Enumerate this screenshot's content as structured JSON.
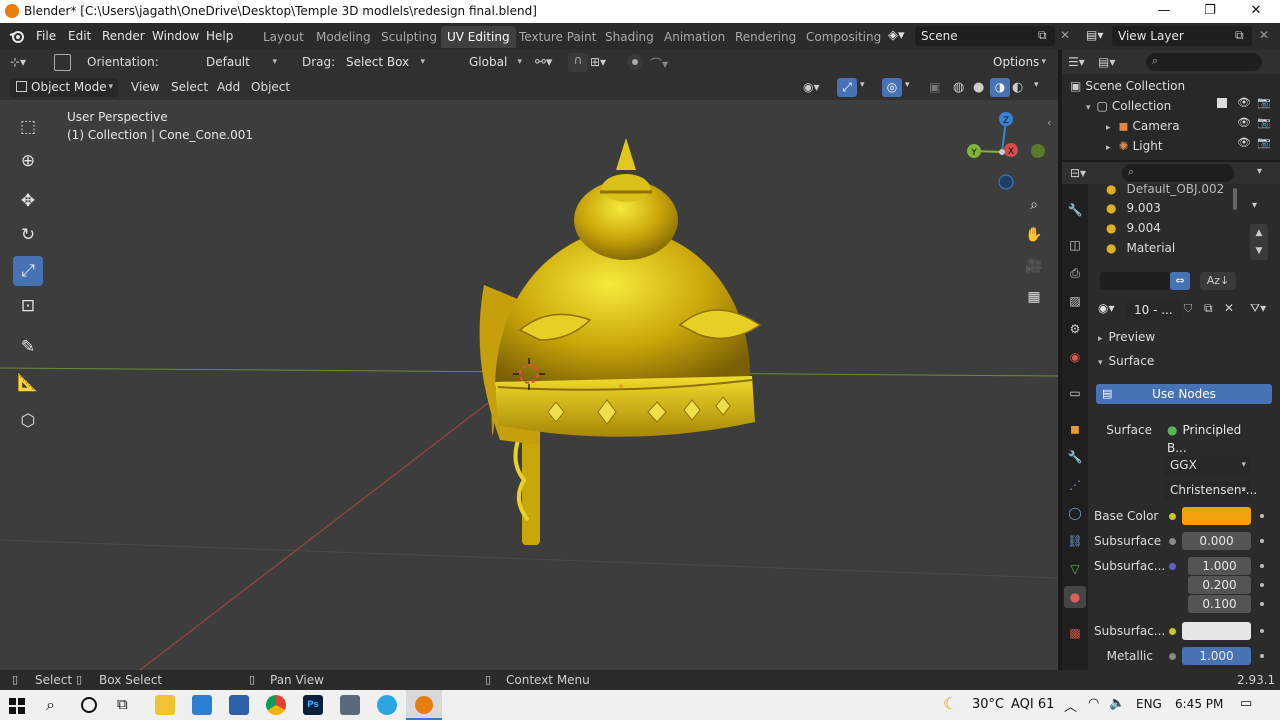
{
  "titlebar": {
    "title": "Blender* [C:\\Users\\jagath\\OneDrive\\Desktop\\Temple 3D modlels\\redesign final.blend]",
    "minimize_glyph": "—",
    "maximize_glyph": "❐",
    "close_glyph": "✕"
  },
  "menu": {
    "items": [
      "File",
      "Edit",
      "Render",
      "Window",
      "Help"
    ],
    "workspaces": [
      "Layout",
      "Modeling",
      "Sculpting",
      "UV Editing",
      "Texture Paint",
      "Shading",
      "Animation",
      "Rendering",
      "Compositing"
    ],
    "active_workspace": "UV Editing",
    "scene_name": "Scene",
    "view_layer_name": "View Layer"
  },
  "tool_header": {
    "orientation_label": "Orientation:",
    "orientation_value": "Default",
    "drag_label": "Drag:",
    "drag_value": "Select Box",
    "transform_orientation": "Global",
    "options_label": "Options"
  },
  "view_header": {
    "mode": "Object Mode",
    "menus": [
      "View",
      "Select",
      "Add",
      "Object"
    ]
  },
  "viewport": {
    "perspective_text": "User Perspective",
    "collection_text": "(1) Collection | Cone_Cone.001",
    "gizmo_axes": [
      "Z",
      "Y",
      "X"
    ]
  },
  "outliner": {
    "root": "Scene Collection",
    "items": [
      {
        "label": "Collection",
        "indent": 1
      },
      {
        "label": "Camera",
        "indent": 2
      },
      {
        "label": "Light",
        "indent": 2
      }
    ]
  },
  "properties": {
    "material_slots": [
      "Default_OBJ.002",
      "9.003",
      "9.004",
      "Material"
    ],
    "material_name": "10 - ...",
    "panels": {
      "preview": "Preview",
      "surface": "Surface"
    },
    "use_nodes_label": "Use Nodes",
    "surface_label": "Surface",
    "surface_value": "Principled B...",
    "distribution": "GGX",
    "subsurface_method": "Christensen-...",
    "fields": {
      "base_color_label": "Base Color",
      "base_color": "#f2a20c",
      "subsurface_label": "Subsurface",
      "subsurface_value": "0.000",
      "subsurface_radius_label": "Subsurfac...",
      "subsurface_radius": [
        "1.000",
        "0.200",
        "0.100"
      ],
      "subsurface_color_label": "Subsurfac...",
      "subsurface_color": "#e6e6e6",
      "metallic_label": "Metallic",
      "metallic_value": "1.000"
    }
  },
  "statusbar": {
    "select": "Select",
    "box_select": "Box Select",
    "pan_view": "Pan View",
    "context_menu": "Context Menu",
    "version": "2.93.1"
  },
  "taskbar": {
    "temperature": "30°C",
    "aqi": "AQI 61",
    "language": "ENG",
    "time": "6:45 PM"
  },
  "colors": {
    "accent": "#4772b3",
    "gold": "#c9a20c",
    "axis_x": "#d54b4b",
    "axis_y": "#7fb33a",
    "axis_z": "#3a82d5"
  }
}
